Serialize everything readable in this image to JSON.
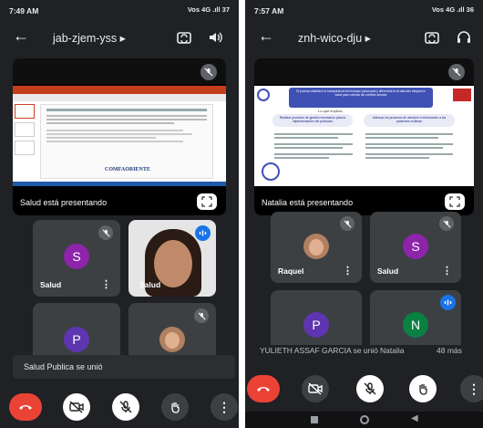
{
  "left": {
    "status": {
      "time": "7:49 AM",
      "right": "Vos 4G  .ıll  37"
    },
    "meeting_code": "jab-zjem-yss",
    "presenting": "Salud está presentando",
    "slide_logo": "COMFAORIENTE",
    "tiles": [
      {
        "initial": "S",
        "name": "Salud",
        "color": "#8e24aa"
      },
      {
        "name": "Salud"
      },
      {
        "initial": "P",
        "color": "#5e35b1"
      },
      {}
    ],
    "toast": "Salud Publica se unió"
  },
  "right": {
    "status": {
      "time": "7:57 AM",
      "right": "Vos 4G  .ıll  36"
    },
    "meeting_code": "znh-wico-dju",
    "presenting": "Natalia está presentando",
    "slide_title": "El proceso establece la transparencia del enfoque psicosocial y diferencial en la atención integral en salud para víctimas del conflicto armado",
    "slide_subtitle": "Lo que implica...",
    "slide_left_head": "Realizar procesos de gestión necesarios para la implementación del protocolo",
    "slide_right_head": "Adecuar los procesos de atención e información a los pacientes víctimas",
    "tiles": [
      {
        "name": "Raquel"
      },
      {
        "initial": "S",
        "name": "Salud",
        "color": "#8e24aa"
      },
      {
        "initial": "P",
        "color": "#5e35b1"
      },
      {
        "initial": "N",
        "color": "#0b8043"
      }
    ],
    "ticker_name": "YULIETH ASSAF GARCIA se unió",
    "ticker_mid": "Natalia",
    "ticker_more": "48 más"
  },
  "colors": {
    "hangup": "#ea4335",
    "background": "#202124",
    "tile": "#3c4043",
    "speaking": "#1a73e8"
  },
  "icons": [
    "back-arrow-icon",
    "camera-switch-icon",
    "speaker-icon",
    "headphones-icon",
    "mic-off-icon",
    "expand-icon",
    "more-vert-icon",
    "audio-wave-icon",
    "hangup-icon",
    "camera-off-icon",
    "raise-hand-icon",
    "more-options-icon"
  ]
}
